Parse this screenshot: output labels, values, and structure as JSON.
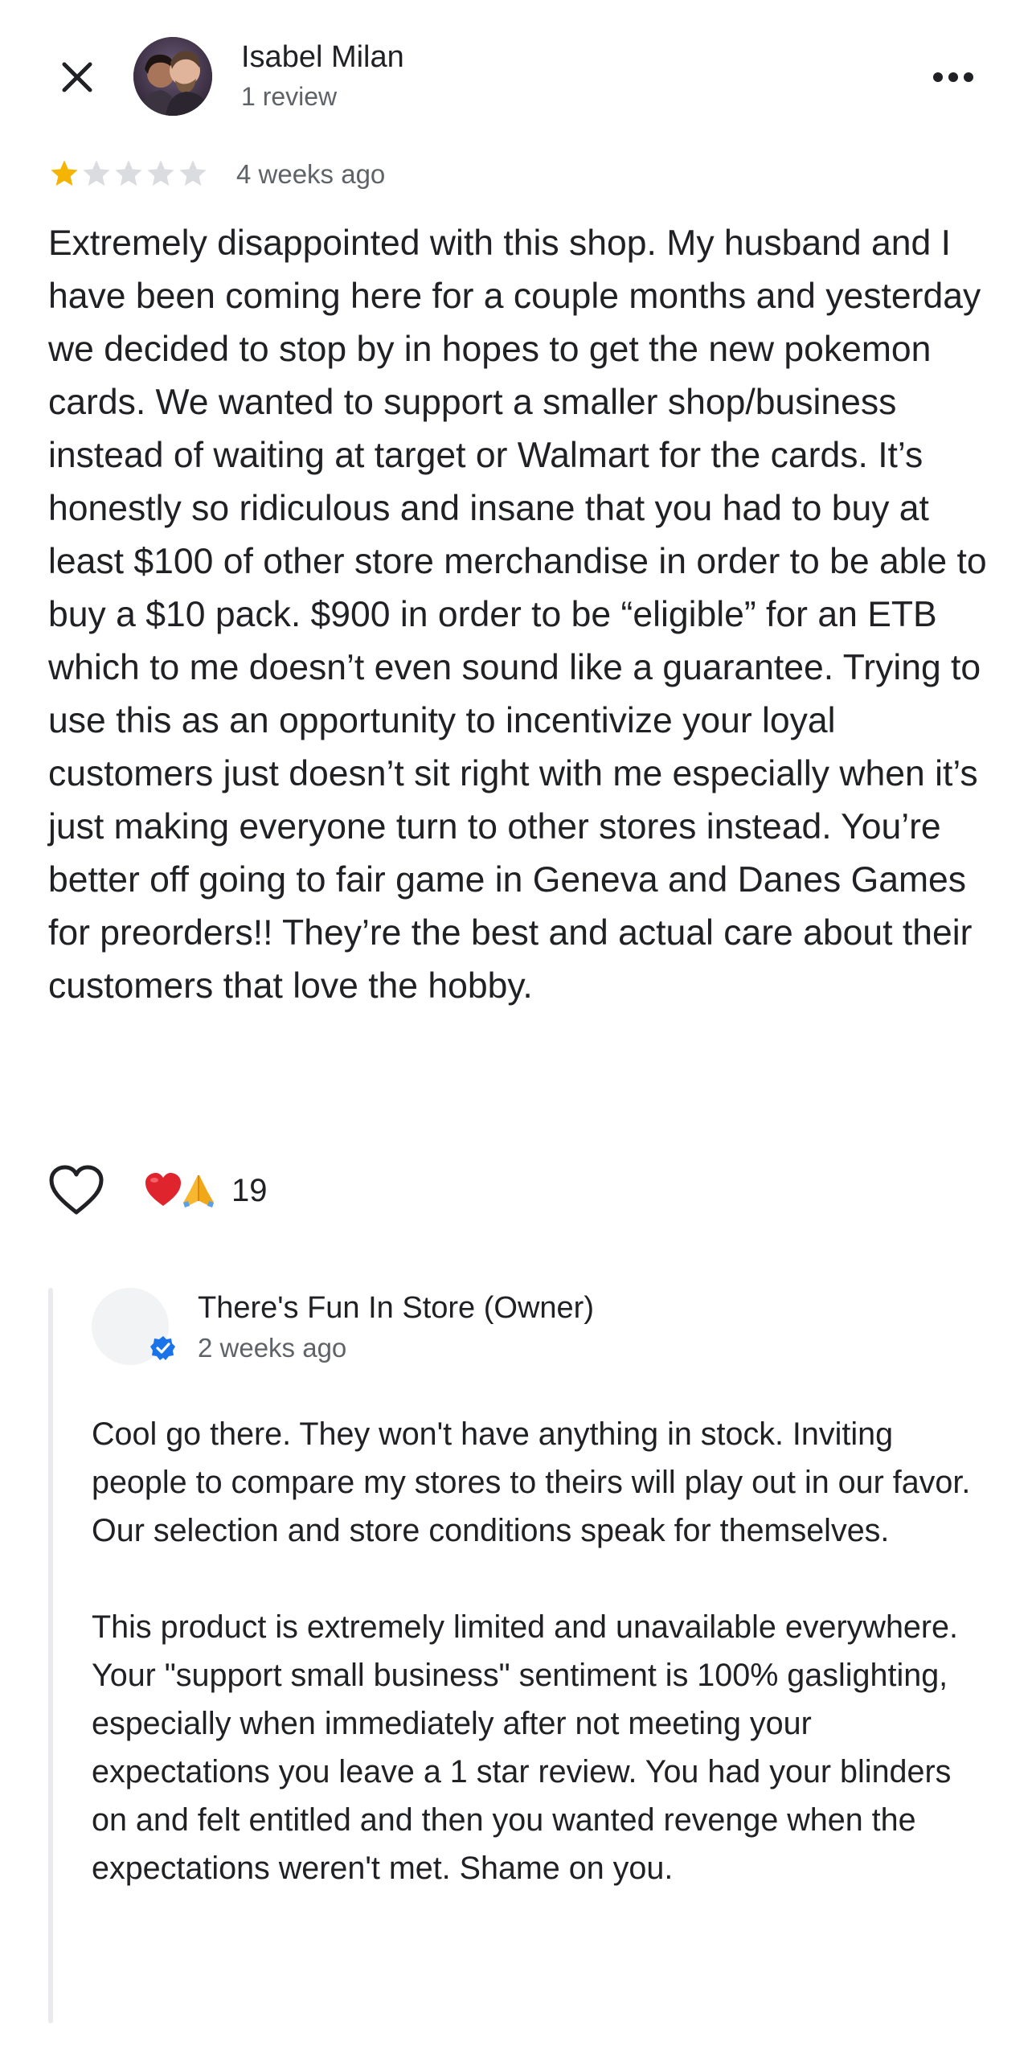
{
  "review": {
    "reviewer_name": "Isabel Milan",
    "reviewer_count": "1 review",
    "rating": 1,
    "rating_max": 5,
    "date": "4 weeks ago",
    "text": "Extremely disappointed with this shop. My husband and I have been coming here for a couple months and yesterday we decided to stop by in hopes to get the new pokemon cards. We wanted to support a smaller shop/business instead of waiting at target or Walmart for the cards. It’s honestly so ridiculous and insane that you had to buy at least $100 of other store merchandise in order to be able to buy a $10 pack. $900 in order to be “eligible” for an ETB which to me doesn’t even sound like a guarantee. Trying to use this as an opportunity to incentivize your loyal customers just doesn’t sit right with me especially when it’s just making everyone turn to other stores instead. You’re better off going to fair game in Geneva and Danes Games for preorders!! They’re the best and actual care about their customers that love the hobby."
  },
  "reactions": {
    "emojis": [
      "heart-emoji",
      "folded-hands-emoji"
    ],
    "count": "19"
  },
  "owner_reply": {
    "name": "There's Fun In Store (Owner)",
    "date": "2 weeks ago",
    "paragraphs": [
      "Cool go there. They won't have anything in stock. Inviting people to compare my stores to theirs will play out in our favor. Our selection and store conditions speak for themselves.",
      "This product is extremely limited and unavailable everywhere. Your \"support small business\" sentiment is 100% gaslighting, especially when immediately after not meeting your expectations you leave a 1 star review. You had your blinders on and felt entitled and then you wanted revenge when the expectations weren't met. Shame on you."
    ]
  },
  "icons": {
    "close": "close-icon",
    "more": "more-horizontal-icon",
    "like": "heart-outline-icon",
    "verified": "verified-badge-icon"
  },
  "colors": {
    "star_filled": "#F4B400",
    "star_empty": "#DADCE0",
    "verified_blue": "#1A73E8",
    "secondary_text": "#5F6368",
    "reply_bar": "#E8EAED"
  }
}
